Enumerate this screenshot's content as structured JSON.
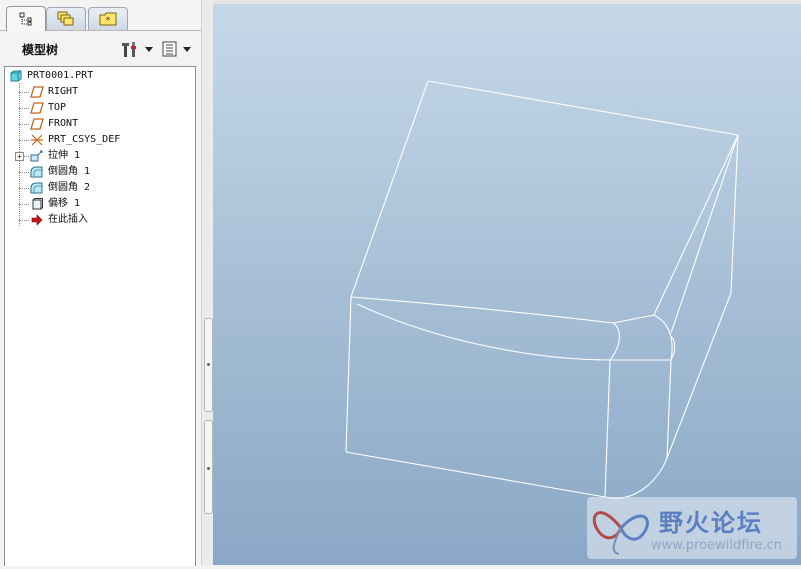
{
  "tabs": [
    {
      "icon": "model-tree-icon",
      "active": true
    },
    {
      "icon": "layers-icon",
      "active": false
    },
    {
      "icon": "favorites-icon",
      "active": false
    }
  ],
  "panel": {
    "title": "模型树",
    "settings_icon": "tree-settings-icon",
    "show_icon": "tree-columns-icon"
  },
  "tree": {
    "root": {
      "label": "PRT0001.PRT",
      "icon": "part-icon"
    },
    "items": [
      {
        "label": "RIGHT",
        "icon": "datum-plane-icon"
      },
      {
        "label": "TOP",
        "icon": "datum-plane-icon"
      },
      {
        "label": "FRONT",
        "icon": "datum-plane-icon"
      },
      {
        "label": "PRT_CSYS_DEF",
        "icon": "csys-icon"
      },
      {
        "label": "拉伸 1",
        "icon": "extrude-icon",
        "expandable": true
      },
      {
        "label": "倒圆角 1",
        "icon": "round-icon"
      },
      {
        "label": "倒圆角 2",
        "icon": "round-icon"
      },
      {
        "label": "偏移 1",
        "icon": "offset-icon"
      },
      {
        "label": "在此插入",
        "icon": "insert-here-arrow-icon"
      }
    ]
  },
  "colors": {
    "accent_red": "#cc1111",
    "plane_orange": "#c5651d",
    "viewport_top": "#c5d8e8",
    "viewport_bottom": "#8aa8c6"
  },
  "watermark": {
    "name": "野火论坛",
    "url": "www.proewildfire.cn"
  }
}
